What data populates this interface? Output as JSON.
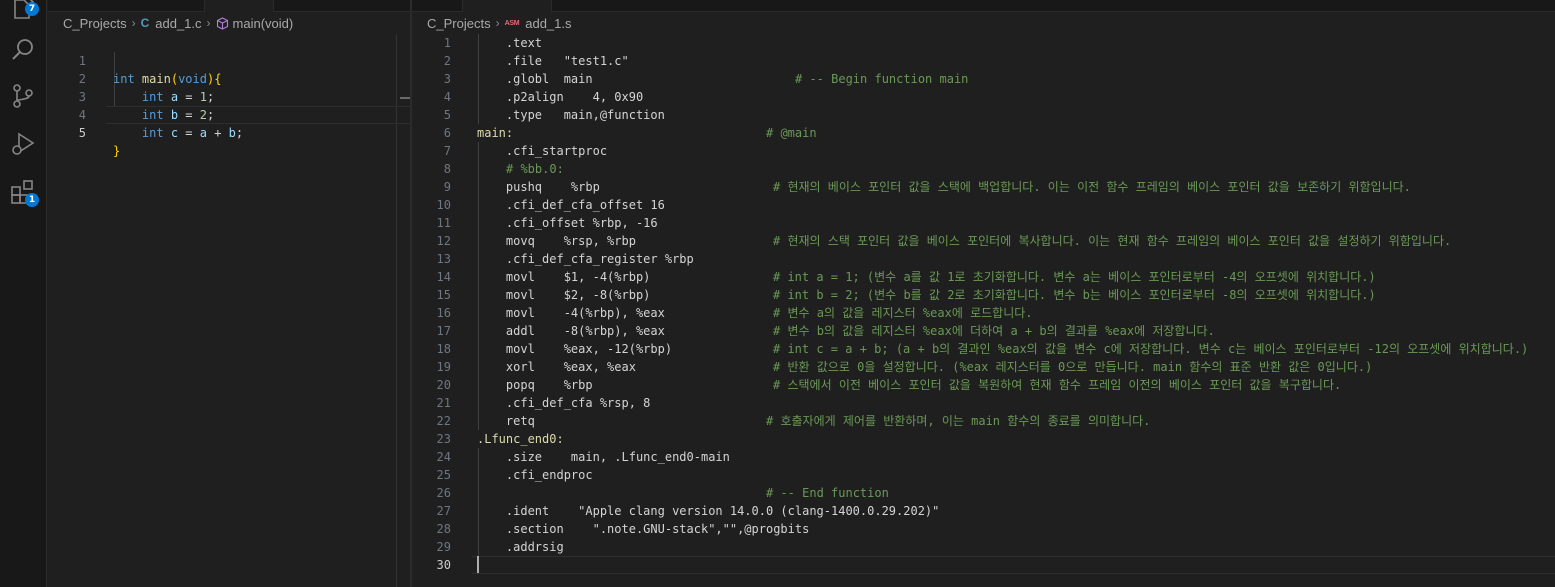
{
  "activity_bar": {
    "explorer_badge": "7",
    "extensions_badge": "1"
  },
  "left_editor": {
    "breadcrumb": {
      "folder": "C_Projects",
      "file": "add_1.c",
      "file_icon": "C",
      "symbol": "main(void)"
    },
    "lines": [
      {
        "n": "1"
      },
      {
        "n": "2"
      },
      {
        "n": "3"
      },
      {
        "n": "4"
      },
      {
        "n": "5"
      }
    ],
    "code": {
      "l1": {
        "type": "int",
        "name": "main",
        "param": "void"
      },
      "l2": {
        "type": "int",
        "var": "a",
        "eq": " = ",
        "val": "1",
        "semi": ";"
      },
      "l3": {
        "type": "int",
        "var": "b",
        "eq": " = ",
        "val": "2",
        "semi": ";"
      },
      "l4": {
        "type": "int",
        "var": "c",
        "eq": " = ",
        "a": "a",
        "plus": " + ",
        "b": "b",
        "semi": ";"
      },
      "l5": {
        "close": "}"
      }
    }
  },
  "right_editor": {
    "breadcrumb": {
      "folder": "C_Projects",
      "file_icon": "ASM",
      "file": "add_1.s"
    },
    "lines": [
      {
        "n": "1",
        "code": "    .text",
        "comment": ""
      },
      {
        "n": "2",
        "code": "    .file   \"test1.c\"",
        "comment": ""
      },
      {
        "n": "3",
        "code": "    .globl  main",
        "comment": "# -- Begin function main"
      },
      {
        "n": "4",
        "code": "    .p2align    4, 0x90",
        "comment": ""
      },
      {
        "n": "5",
        "code": "    .type   main,@function",
        "comment": ""
      },
      {
        "n": "6",
        "code": "main:",
        "comment": "# @main"
      },
      {
        "n": "7",
        "code": "    .cfi_startproc",
        "comment": ""
      },
      {
        "n": "8",
        "code": "",
        "comment": "# %bb.0:"
      },
      {
        "n": "9",
        "code": "    pushq    %rbp",
        "comment": "# 현재의 베이스 포인터 값을 스택에 백업합니다. 이는 이전 함수 프레임의 베이스 포인터 값을 보존하기 위함입니다."
      },
      {
        "n": "10",
        "code": "    .cfi_def_cfa_offset 16",
        "comment": ""
      },
      {
        "n": "11",
        "code": "    .cfi_offset %rbp, -16",
        "comment": ""
      },
      {
        "n": "12",
        "code": "    movq    %rsp, %rbp",
        "comment": "# 현재의 스택 포인터 값을 베이스 포인터에 복사합니다. 이는 현재 함수 프레임의 베이스 포인터 값을 설정하기 위함입니다."
      },
      {
        "n": "13",
        "code": "    .cfi_def_cfa_register %rbp",
        "comment": ""
      },
      {
        "n": "14",
        "code": "    movl    $1, -4(%rbp)",
        "comment": "# int a = 1; (변수 a를 값 1로 초기화합니다. 변수 a는 베이스 포인터로부터 -4의 오프셋에 위치합니다.)"
      },
      {
        "n": "15",
        "code": "    movl    $2, -8(%rbp)",
        "comment": "# int b = 2; (변수 b를 값 2로 초기화합니다. 변수 b는 베이스 포인터로부터 -8의 오프셋에 위치합니다.)"
      },
      {
        "n": "16",
        "code": "    movl    -4(%rbp), %eax",
        "comment": "# 변수 a의 값을 레지스터 %eax에 로드합니다."
      },
      {
        "n": "17",
        "code": "    addl    -8(%rbp), %eax",
        "comment": "# 변수 b의 값을 레지스터 %eax에 더하여 a + b의 결과를 %eax에 저장합니다."
      },
      {
        "n": "18",
        "code": "    movl    %eax, -12(%rbp)",
        "comment": "# int c = a + b; (a + b의 결과인 %eax의 값을 변수 c에 저장합니다. 변수 c는 베이스 포인터로부터 -12의 오프셋에 위치합니다.)"
      },
      {
        "n": "19",
        "code": "    xorl    %eax, %eax",
        "comment": "# 반환 값으로 0을 설정합니다. (%eax 레지스터를 0으로 만듭니다. main 함수의 표준 반환 값은 0입니다.)"
      },
      {
        "n": "20",
        "code": "    popq    %rbp",
        "comment": "# 스택에서 이전 베이스 포인터 값을 복원하여 현재 함수 프레임 이전의 베이스 포인터 값을 복구합니다."
      },
      {
        "n": "21",
        "code": "    .cfi_def_cfa %rsp, 8",
        "comment": ""
      },
      {
        "n": "22",
        "code": "    retq",
        "comment": "# 호출자에게 제어를 반환하며, 이는 main 함수의 종료를 의미합니다."
      },
      {
        "n": "23",
        "code": ".Lfunc_end0:",
        "comment": ""
      },
      {
        "n": "24",
        "code": "    .size    main, .Lfunc_end0-main",
        "comment": ""
      },
      {
        "n": "25",
        "code": "    .cfi_endproc",
        "comment": ""
      },
      {
        "n": "26",
        "code": "",
        "comment": "# -- End function"
      },
      {
        "n": "27",
        "code": "    .ident    \"Apple clang version 14.0.0 (clang-1400.0.29.202)\"",
        "comment": ""
      },
      {
        "n": "28",
        "code": "    .section    \".note.GNU-stack\",\"\",@progbits",
        "comment": ""
      },
      {
        "n": "29",
        "code": "    .addrsig",
        "comment": ""
      },
      {
        "n": "30",
        "code": "",
        "comment": ""
      }
    ]
  }
}
